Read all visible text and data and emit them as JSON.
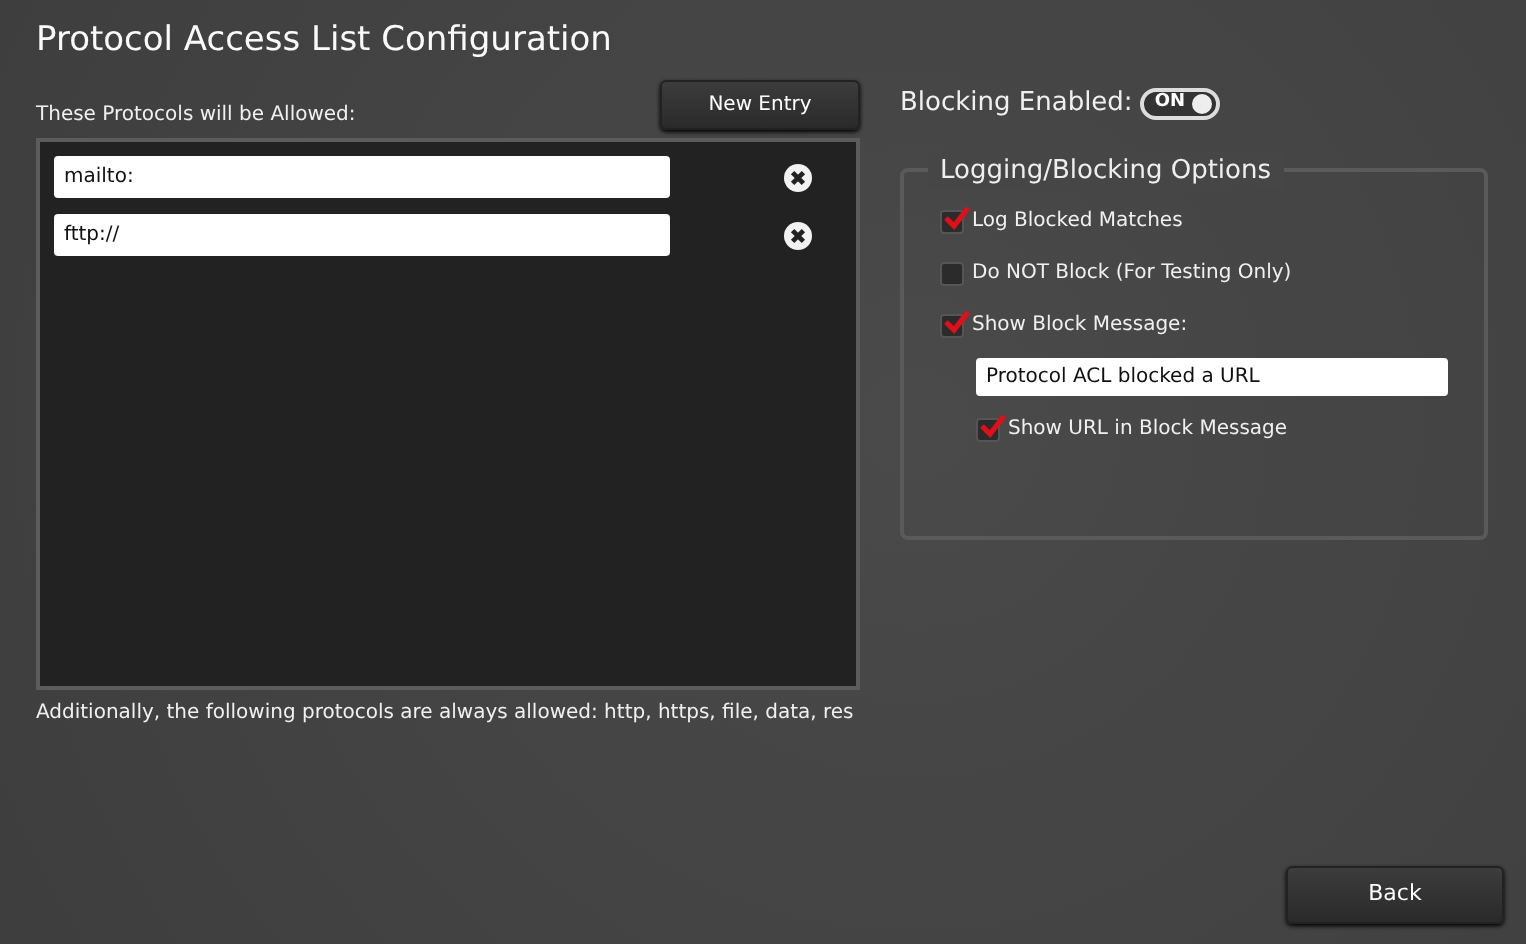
{
  "title": "Protocol Access List Configuration",
  "allowed_label": "These Protocols will be Allowed:",
  "new_entry_button": "New Entry",
  "entries": [
    {
      "value": "mailto:"
    },
    {
      "value": "fttp://"
    }
  ],
  "footnote": "Additionally, the following protocols are always allowed: http, https, file, data, res",
  "blocking": {
    "label": "Blocking Enabled:",
    "toggle_text": "ON",
    "on": true
  },
  "options": {
    "legend": "Logging/Blocking Options",
    "items": [
      {
        "kind": "checkbox",
        "label": "Log Blocked Matches",
        "checked": true
      },
      {
        "kind": "checkbox",
        "label": "Do NOT Block (For Testing Only)",
        "checked": false
      },
      {
        "kind": "checkbox",
        "label": "Show Block Message:",
        "checked": true
      },
      {
        "kind": "text",
        "value": "Protocol ACL blocked a URL"
      },
      {
        "kind": "subcheckbox",
        "label": "Show URL in Block Message",
        "checked": true
      }
    ]
  },
  "back_button": "Back"
}
